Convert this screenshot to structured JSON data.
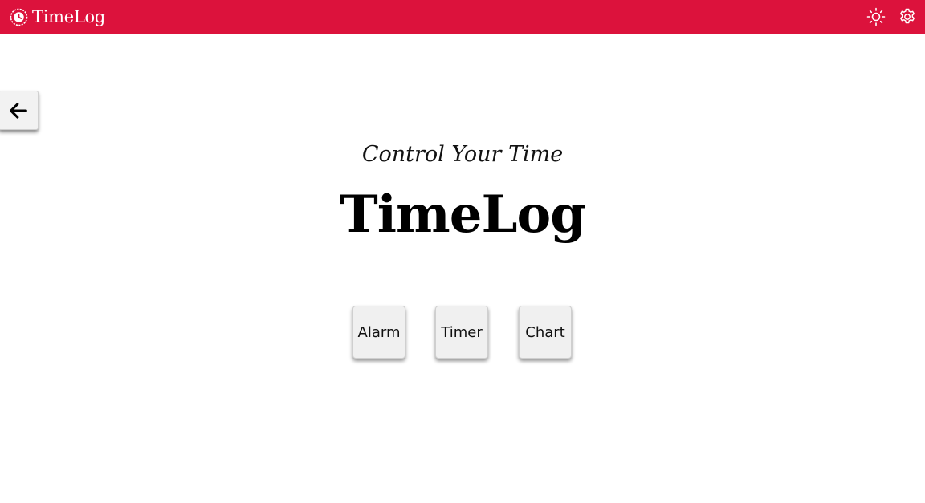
{
  "app": {
    "brand_name": "TimeLog",
    "brand_color": "#dc123c",
    "logo_icon": "clock-logo-icon"
  },
  "header": {
    "icons": [
      "sun-icon",
      "gear-icon"
    ]
  },
  "navigation": {
    "back_icon": "arrow-left-icon"
  },
  "hero": {
    "tagline": "Control Your Time",
    "title": "TimeLog"
  },
  "menu": {
    "buttons": [
      {
        "label": "Alarm"
      },
      {
        "label": "Timer"
      },
      {
        "label": "Chart"
      }
    ]
  }
}
